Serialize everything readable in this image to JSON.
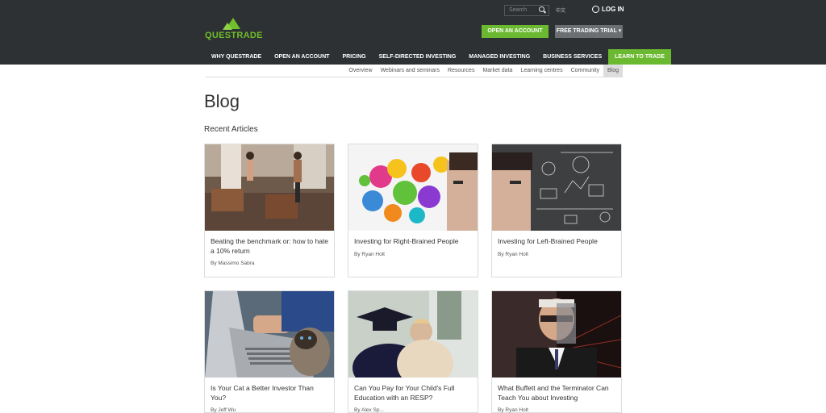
{
  "header": {
    "brand": "QUESTRADE",
    "search_placeholder": "Search",
    "lang": "中文",
    "login": "LOG IN",
    "open_account": "OPEN AN ACCOUNT",
    "free_trial": "FREE TRADING TRIAL"
  },
  "nav": {
    "items": [
      "WHY QUESTRADE",
      "OPEN AN ACCOUNT",
      "PRICING",
      "SELF-DIRECTED INVESTING",
      "MANAGED INVESTING",
      "BUSINESS SERVICES",
      "LEARN TO TRADE"
    ],
    "active_index": 6
  },
  "subnav": {
    "items": [
      "Overview",
      "Webinars and seminars",
      "Resources",
      "Market data",
      "Learning centres",
      "Community",
      "Blog"
    ],
    "active_index": 6
  },
  "page": {
    "title": "Blog",
    "section": "Recent Articles"
  },
  "articles": [
    {
      "title": "Beating the benchmark or: how to hate a 10% return",
      "author": "By Massimo Sabra",
      "image": "gym-photo"
    },
    {
      "title": "Investing for Right-Brained People",
      "author": "By Ryan Holt",
      "image": "paint-splash-head-photo"
    },
    {
      "title": "Investing for Left-Brained People",
      "author": "By Ryan Holt",
      "image": "chalkboard-head-photo"
    },
    {
      "title": "Is Your Cat a Better Investor Than You?",
      "author": "By Jeff Wu",
      "image": "cat-laptop-photo"
    },
    {
      "title": "Can You Pay for Your Child's Full Education with an RESP?",
      "author": "By Alex Sp...",
      "image": "graduation-hug-photo"
    },
    {
      "title": "What Buffett and the Terminator Can Teach You about Investing",
      "author": "By Ryan Holt",
      "image": "buffett-terminator-photo"
    }
  ],
  "colors": {
    "header_bg": "#2e3133",
    "accent": "#6bb930",
    "trial_btn": "#6b6f72"
  }
}
